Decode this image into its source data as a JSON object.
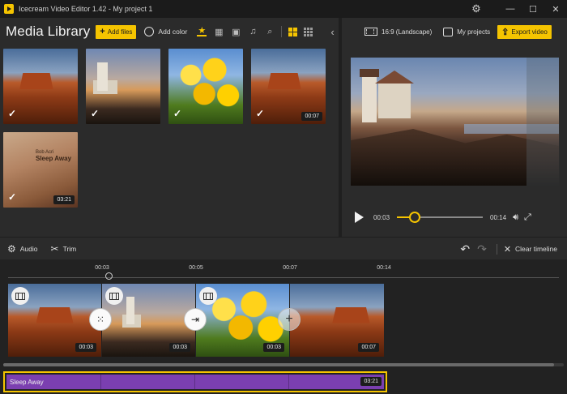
{
  "window": {
    "title": "Icecream Video Editor 1.42 - My project 1",
    "controls": {
      "settings": "⚙",
      "minimize": "—",
      "maximize": "☐",
      "close": "✕"
    }
  },
  "library": {
    "title": "Media Library",
    "add_files_label": "Add files",
    "add_color_label": "Add color",
    "filters": [
      {
        "icon": "star-icon",
        "glyph": "★",
        "active": true
      },
      {
        "icon": "film-icon",
        "glyph": "▦",
        "active": false
      },
      {
        "icon": "image-icon",
        "glyph": "▣",
        "active": false
      },
      {
        "icon": "music-icon",
        "glyph": "♫",
        "active": false
      },
      {
        "icon": "search-icon",
        "glyph": "⌕",
        "active": false
      }
    ],
    "collapse_glyph": "‹",
    "items": [
      {
        "kind": "desert",
        "checked": true,
        "duration": ""
      },
      {
        "kind": "lighthouse",
        "checked": true,
        "duration": ""
      },
      {
        "kind": "tulips",
        "checked": true,
        "duration": ""
      },
      {
        "kind": "desert",
        "checked": true,
        "duration": "00:07"
      },
      {
        "kind": "album",
        "checked": true,
        "duration": "03:21",
        "album_artist": "Bob Acri",
        "album_title": "Sleep Away"
      }
    ]
  },
  "preview": {
    "aspect_label": "16:9 (Landscape)",
    "my_projects_label": "My projects",
    "export_label": "Export video",
    "current_time": "00:03",
    "end_time": "00:14",
    "progress": 0.21
  },
  "toolbar": {
    "audio_label": "Audio",
    "trim_label": "Trim",
    "clear_label": "Clear timeline",
    "undo_glyph": "↶",
    "redo_glyph": "↷"
  },
  "timeline": {
    "ruler_labels": [
      "00:03",
      "00:05",
      "00:07",
      "00:14"
    ],
    "clips": [
      {
        "kind": "desert",
        "duration": "00:03"
      },
      {
        "kind": "lighthouse",
        "duration": "00:03"
      },
      {
        "kind": "tulips",
        "duration": "00:03"
      },
      {
        "kind": "desert",
        "duration": "00:07"
      }
    ],
    "transitions": [
      {
        "icon": "dots-transition-icon",
        "glyph": "⁙"
      },
      {
        "icon": "push-transition-icon",
        "glyph": "⇥"
      },
      {
        "icon": "add-transition-icon",
        "glyph": "+"
      }
    ],
    "audio": {
      "name": "Sleep Away",
      "duration": "03:21"
    }
  }
}
